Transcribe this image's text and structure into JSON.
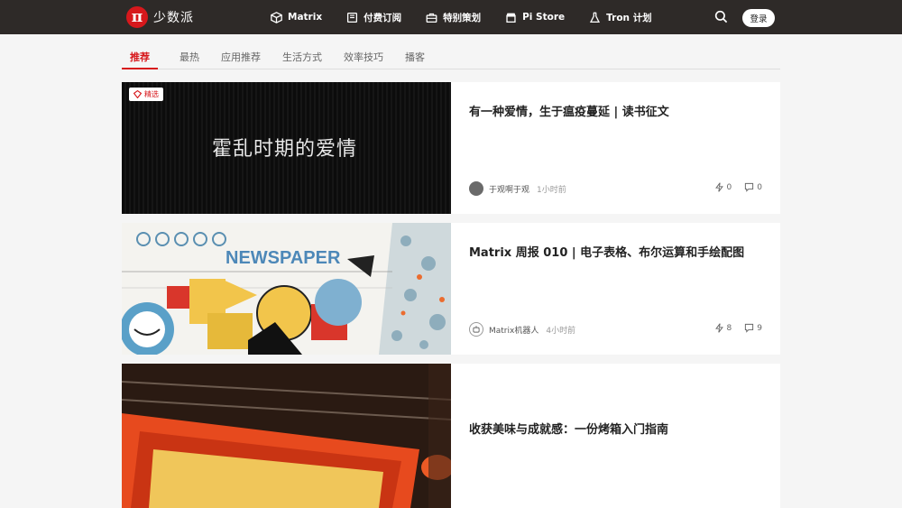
{
  "brand": {
    "name": "少数派",
    "logo_glyph": "π",
    "color": "#d7181c"
  },
  "nav": [
    {
      "label": "Matrix",
      "icon": "cube-icon"
    },
    {
      "label": "付费订阅",
      "icon": "book-icon"
    },
    {
      "label": "特别策划",
      "icon": "briefcase-icon"
    },
    {
      "label": "Pi Store",
      "icon": "store-icon"
    },
    {
      "label": "Tron 计划",
      "icon": "flask-icon"
    }
  ],
  "header": {
    "login_label": "登录"
  },
  "tabs": [
    {
      "label": "推荐",
      "active": true
    },
    {
      "label": "最热"
    },
    {
      "label": "应用推荐"
    },
    {
      "label": "生活方式"
    },
    {
      "label": "效率技巧"
    },
    {
      "label": "播客"
    }
  ],
  "articles": [
    {
      "title": "有一种爱情，生于瘟疫蔓延 | 读书征文",
      "badge": "精选",
      "image_text": "霍乱时期的爱情",
      "author": "于观啊于观",
      "time": "1小时前",
      "likes": "0",
      "comments": "0"
    },
    {
      "title": "Matrix 周报 010 | 电子表格、布尔运算和手绘配图",
      "image_text": "NEWSPAPER",
      "author": "Matrix机器人",
      "time": "4小时前",
      "likes": "8",
      "comments": "9"
    },
    {
      "title": "收获美味与成就感：一份烤箱入门指南"
    }
  ]
}
